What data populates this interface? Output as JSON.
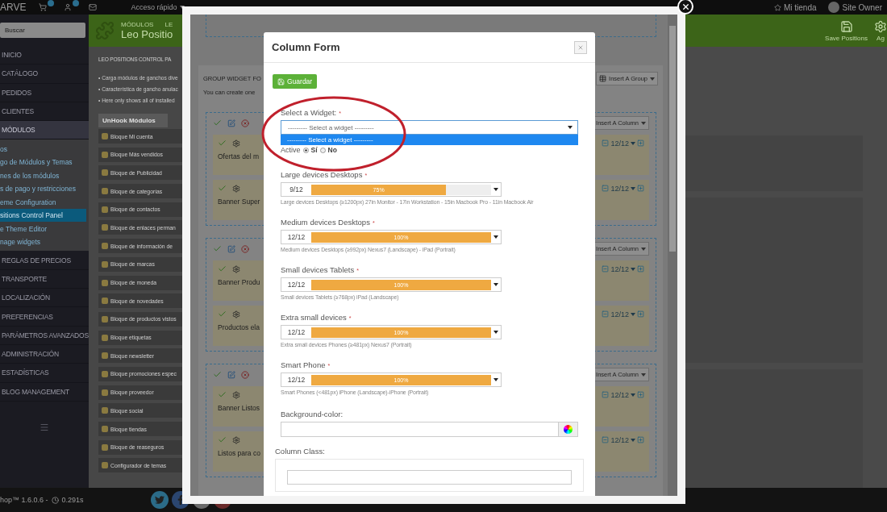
{
  "top_bar": {
    "brand": "ARVE",
    "quick_access": "Acceso rápido",
    "shop_link": "Mi tienda",
    "user": "Site Owner"
  },
  "sidebar": {
    "search": {
      "placeholder": "Buscar"
    },
    "items": [
      {
        "label": "INICIO",
        "selected": false
      },
      {
        "label": "CATÁLOGO",
        "selected": false
      },
      {
        "label": "PEDIDOS",
        "selected": false
      },
      {
        "label": "CLIENTES",
        "selected": false
      },
      {
        "label": "MÓDULOS",
        "selected": true,
        "children": [
          {
            "label": "os",
            "selected": false
          },
          {
            "label": "go de Módulos y Temas",
            "selected": false
          },
          {
            "label": "nes de los módulos",
            "selected": false
          },
          {
            "label": "s de pago y restricciones",
            "selected": false
          },
          {
            "label": "eme Configuration",
            "selected": false
          },
          {
            "label": "sitions Control Panel",
            "selected": true
          },
          {
            "label": "e Theme Editor",
            "selected": false
          },
          {
            "label": "nage widgets",
            "selected": false
          }
        ]
      },
      {
        "label": "REGLAS DE PRECIOS",
        "selected": false
      },
      {
        "label": "TRANSPORTE",
        "selected": false
      },
      {
        "label": "LOCALIZACIÓN",
        "selected": false
      },
      {
        "label": "PREFERENCIAS",
        "selected": false
      },
      {
        "label": "PARÁMETROS AVANZADOS",
        "selected": false
      },
      {
        "label": "ADMINISTRACIÓN",
        "selected": false
      },
      {
        "label": "ESTADÍSTICAS",
        "selected": false
      },
      {
        "label": "BLOG MANAGEMENT",
        "selected": false
      }
    ]
  },
  "page_header": {
    "breadcrumb": [
      "MÓDULOS",
      "LE"
    ],
    "title": "Leo Positio",
    "actions": [
      "Save Positions",
      "Ag"
    ]
  },
  "panel": {
    "title": "LEO POSITIONS CONTROL PA",
    "notes": [
      "• Carga módulos de ganchos dive",
      "• Característica de gancho anulac",
      "• Here only shows all of installed"
    ],
    "tab": "UnHook Módulos",
    "modules": [
      "Bloque Mi cuenta",
      "Bloque Más vendidos",
      "Bloque de Publicidad",
      "Bloque de categorías",
      "Bloque de contactos",
      "Bloque de enlaces perman",
      "Bloque de información de",
      "Bloque de marcas",
      "Bloque de moneda",
      "Bloque de novedades",
      "Bloque de productos vistos",
      "Bloque etiquetas",
      "Bloque newsletter",
      "Bloque promociones espec",
      "Bloque proveedor",
      "Bloque social",
      "Bloque tiendas",
      "Bloque de reaseguros",
      "Configurador de temas"
    ]
  },
  "footer": {
    "version": "hop™ 1.6.0.6 -",
    "time": "0.291s"
  },
  "lightbox": {
    "inner_page": {
      "title": "GROUP WIDGET FO",
      "description": "You can create one",
      "insert_group": "Insert A Group",
      "groups": [
        {
          "insert_column": "Insert A Column",
          "columns": [
            {
              "name": "Ofertas del m",
              "width": "12/12"
            },
            {
              "name": "Banner Super",
              "width": "12/12"
            }
          ]
        },
        {
          "insert_column": "Insert A Column",
          "columns": [
            {
              "name": "Banner Produ",
              "width": "12/12"
            },
            {
              "name": "Productos ela",
              "width": "12/12"
            }
          ]
        },
        {
          "insert_column": "Insert A Column",
          "columns": [
            {
              "name": "Banner Listos",
              "width": "12/12"
            },
            {
              "name": "Listos para co",
              "width": "12/12"
            }
          ]
        }
      ]
    },
    "modal": {
      "title": "Column Form",
      "save": "Guardar",
      "widget": {
        "label": "Select a Widget:",
        "mark": "*",
        "value": "--------- Select a widget ---------",
        "options": [
          {
            "label": "--------- Select a widget ---------",
            "selected": true
          }
        ]
      },
      "active": {
        "label": "Active",
        "options": [
          {
            "label": "Sí",
            "selected": true
          },
          {
            "label": "No",
            "selected": false
          }
        ]
      },
      "sizes": [
        {
          "label": "Large devices Desktops",
          "mark": "*",
          "value": "9/12",
          "level": 0.75,
          "reading": "75%",
          "hint": "Large devices Desktops (≥1200px) 27in Monitor - 17in Workstation - 15in Macbook Pro - 11in Macbook Air"
        },
        {
          "label": "Medium devices Desktops",
          "mark": "*",
          "value": "12/12",
          "level": 1,
          "reading": "100%",
          "hint": "Medium devices Desktops (≥992px) Nexus7 (Landscape) - iPad (Portrait)"
        },
        {
          "label": "Small devices Tablets",
          "mark": "*",
          "value": "12/12",
          "level": 1,
          "reading": "100%",
          "hint": "Small devices Tablets (≥768px) iPad (Landscape)"
        },
        {
          "label": "Extra small devices",
          "mark": "*",
          "value": "12/12",
          "level": 1,
          "reading": "100%",
          "hint": "Extra small devices Phones (≥481px) Nexus7 (Portrait)"
        },
        {
          "label": "Smart Phone",
          "mark": "*",
          "value": "12/12",
          "level": 1,
          "reading": "100%",
          "hint": "Smart Phones (<481px) iPhone (Landscape)-iPhone (Portrait)"
        }
      ],
      "background_color": {
        "label": "Background-color:"
      },
      "column_class": {
        "label": "Column Class:"
      }
    }
  }
}
